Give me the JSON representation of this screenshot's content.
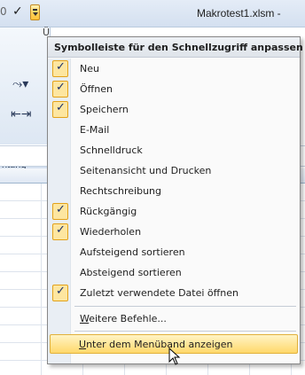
{
  "window": {
    "title": "Makrotest1.xlsm -",
    "left_fragment": "0"
  },
  "ribbon": {
    "tab_fragment": "Ü",
    "group_label": "ntung"
  },
  "menu": {
    "header": "Symbolleiste für den Schnellzugriff anpassen",
    "items": [
      {
        "label": "Neu",
        "checked": true
      },
      {
        "label": "Öffnen",
        "checked": true
      },
      {
        "label": "Speichern",
        "checked": true
      },
      {
        "label": "E-Mail",
        "checked": false
      },
      {
        "label": "Schnelldruck",
        "checked": false
      },
      {
        "label": "Seitenansicht und Drucken",
        "checked": false
      },
      {
        "label": "Rechtschreibung",
        "checked": false
      },
      {
        "label": "Rückgängig",
        "checked": true
      },
      {
        "label": "Wiederholen",
        "checked": true
      },
      {
        "label": "Aufsteigend sortieren",
        "checked": false
      },
      {
        "label": "Absteigend sortieren",
        "checked": false
      },
      {
        "label": "Zuletzt verwendete Datei öffnen",
        "checked": true
      }
    ],
    "more_commands": {
      "accel": "W",
      "rest": "eitere Befehle..."
    },
    "show_below": {
      "accel": "U",
      "rest": "nter dem Menüband anzeigen"
    }
  },
  "icons": {
    "check": "✓",
    "cursor": "mouse-pointer"
  },
  "colors": {
    "highlight": "#ffd86b",
    "check_box": "#fde6a0",
    "menu_border": "#868686"
  }
}
